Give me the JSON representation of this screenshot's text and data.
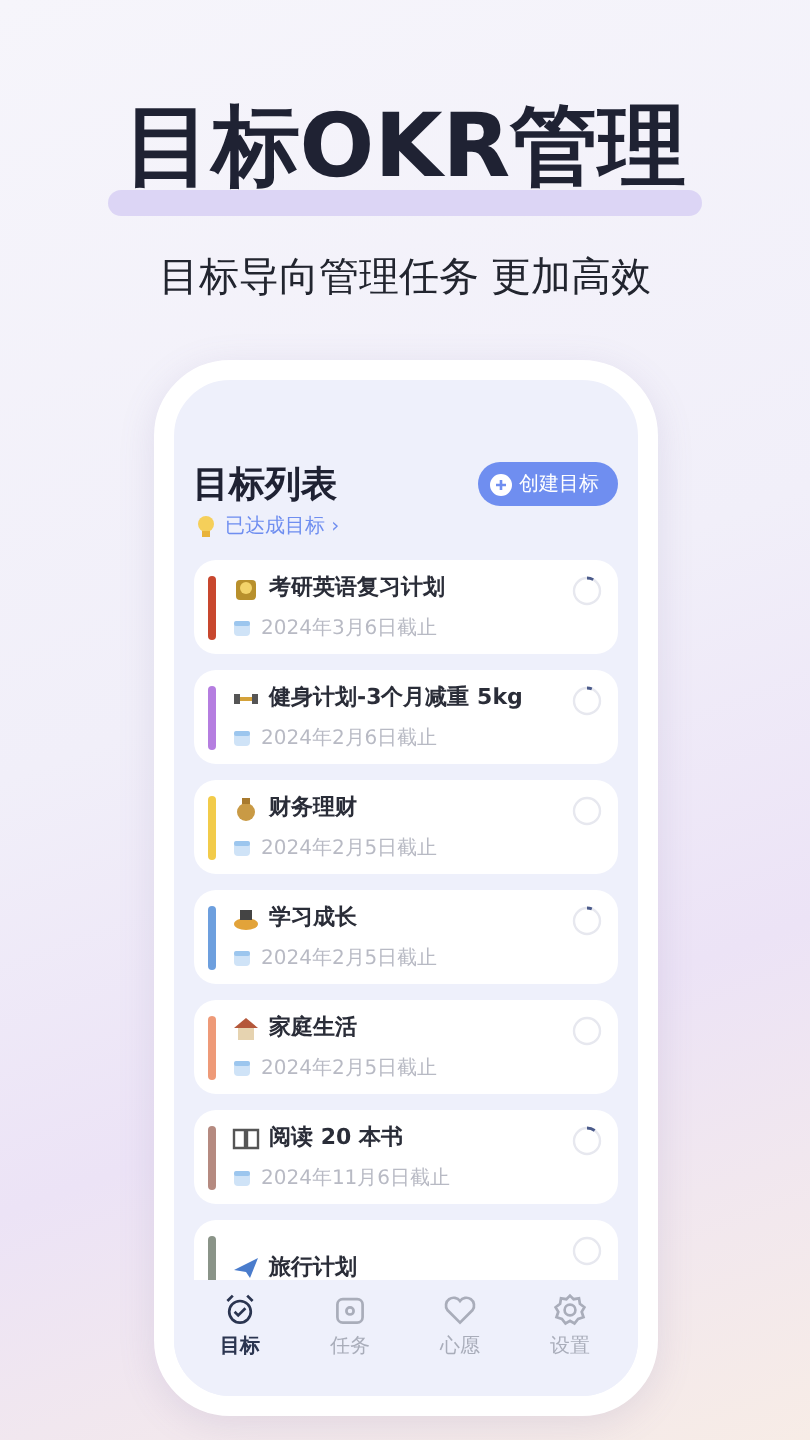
{
  "headline": "目标OKR管理",
  "subtitle": "目标导向管理任务 更加高效",
  "screen": {
    "title": "目标列表",
    "create_button": "创建目标",
    "achieved_link": "已达成目标 ›",
    "goals": [
      {
        "title": "考研英语复习计划",
        "deadline": "2024年3月6日截止",
        "color": "#c8472e",
        "level": 0.08
      },
      {
        "title": "健身计划-3个月减重 5kg",
        "deadline": "2024年2月6日截止",
        "color": "#b57ee0",
        "level": 0.06
      },
      {
        "title": "财务理财",
        "deadline": "2024年2月5日截止",
        "color": "#f2cb4a",
        "level": 0
      },
      {
        "title": "学习成长",
        "deadline": "2024年2月5日截止",
        "color": "#6d9fde",
        "level": 0.06
      },
      {
        "title": "家庭生活",
        "deadline": "2024年2月5日截止",
        "color": "#ee9a78",
        "level": 0
      },
      {
        "title": "阅读 20 本书",
        "deadline": "2024年11月6日截止",
        "color": "#b58a80",
        "level": 0.1
      },
      {
        "title": "旅行计划",
        "color": "#8a9488",
        "level": 0
      }
    ],
    "tabs": [
      {
        "label": "目标",
        "selected": true
      },
      {
        "label": "任务",
        "selected": false
      },
      {
        "label": "心愿",
        "selected": false
      },
      {
        "label": "设置",
        "selected": false
      }
    ]
  }
}
